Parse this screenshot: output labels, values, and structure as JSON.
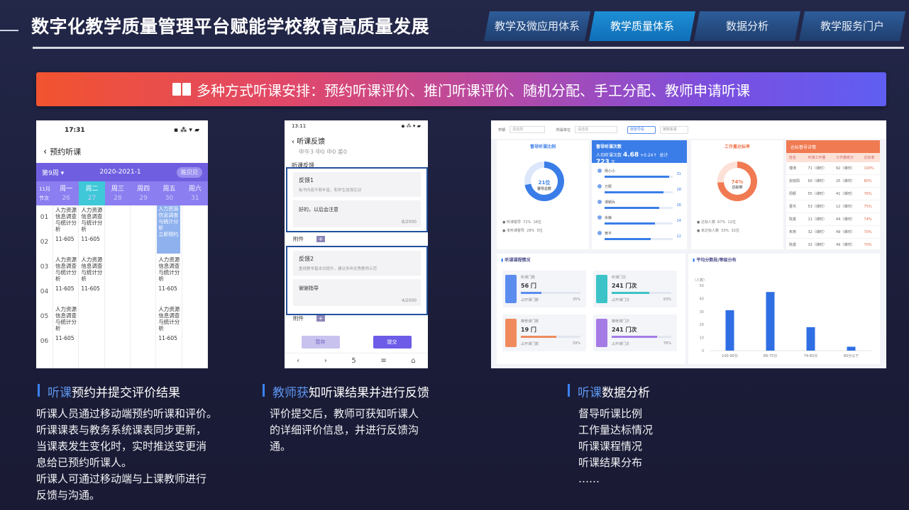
{
  "header": {
    "title": "数字化教学质量管理平台赋能学校教育高质量发展",
    "tabs": [
      {
        "label": "教学及微应用体系",
        "active": false
      },
      {
        "label": "教学质量体系",
        "active": true
      },
      {
        "label": "数据分析",
        "active": false
      },
      {
        "label": "教学服务门户",
        "active": false
      }
    ]
  },
  "banner": {
    "text": "多种方式听课安排：预约听课评价、推门听课评价、随机分配、手工分配、教师申请听课",
    "icon": "book-icon"
  },
  "phone1": {
    "status_time": "17:31",
    "status_icons": "▪ ⁂ ▾ ▰",
    "nav_title": "预约听课",
    "week": "第9周",
    "term": "2020-2021-1",
    "user_pill": "陈贝贝",
    "month": "11月",
    "section_label": "节次",
    "days": [
      {
        "name": "周一",
        "date": "26"
      },
      {
        "name": "周二",
        "date": "27"
      },
      {
        "name": "周三",
        "date": "28"
      },
      {
        "name": "周四",
        "date": "29"
      },
      {
        "name": "周五",
        "date": "30"
      },
      {
        "name": "周六",
        "date": "31"
      }
    ],
    "periods": [
      "01",
      "02",
      "03",
      "04",
      "05",
      "06"
    ],
    "course_name": "人力资源信息调查与统计分析",
    "course_room": "11-605",
    "highlight_text": "人力资源信息调查与统计分析",
    "highlight_action": "立即预约"
  },
  "phone2": {
    "status_time": "13:11",
    "status_icons": "▪ ⁂ ▾ ▰",
    "nav_title": "听课反馈",
    "faded_line": "中午3 中0 中0 差0",
    "section_label": "听课反馈",
    "feedbacks": [
      {
        "title": "反馈1",
        "hint": "板书内容不够丰富，和学生加强互动",
        "reply": "好的，以后会注意",
        "count": "8/2000"
      },
      {
        "title": "反馈2",
        "hint": "重视教学基本功提升，建议多听优秀教师示范",
        "reply": "谢谢指导",
        "count": "4/2000"
      }
    ],
    "attach_label": "附件",
    "btn_save": "暂存",
    "btn_submit": "提交",
    "nav_icons": [
      "‹",
      "›",
      "5",
      "≡",
      "⌂"
    ]
  },
  "dashboard": {
    "filter_labels": [
      "学期",
      "所属单位"
    ],
    "filter_placeholders": [
      "请选择",
      "请选择"
    ],
    "toggles": [
      "按督导看",
      "按院系看"
    ],
    "card1": {
      "title": "督导听课比例",
      "center_value": "21位",
      "center_label": "督导总数",
      "legend": [
        {
          "label": "听课督导",
          "pct": "72%",
          "count": "16位"
        },
        {
          "label": "未听课督导",
          "pct": "28%",
          "count": "5位"
        }
      ]
    },
    "card2": {
      "title": "督导听课次数",
      "sub": "人均听课次数",
      "avg": "4.68",
      "delta": "+0.24↑",
      "total_label": "总计",
      "total": "723",
      "unit": "次",
      "people": [
        {
          "name": "杨小小",
          "value": 31,
          "pct": 0.95
        },
        {
          "name": "万颖",
          "value": 28,
          "pct": 0.86
        },
        {
          "name": "谭朝兵",
          "value": 26,
          "pct": 0.8
        },
        {
          "name": "余静",
          "value": 24,
          "pct": 0.74
        },
        {
          "name": "黄平",
          "value": 22,
          "pct": 0.68
        }
      ]
    },
    "card3": {
      "title": "工作量达标率",
      "center_value": "74%",
      "center_label": "达标率",
      "legend": [
        {
          "label": "达标人数",
          "pct": "67%",
          "count": "12位"
        },
        {
          "label": "未达标人数",
          "pct": "33%",
          "count": "32位"
        }
      ]
    },
    "card4": {
      "title": "达标督导详情",
      "headers": [
        "姓名",
        "听课工作量",
        "工作量统计",
        "达标率"
      ],
      "rows": [
        [
          "傅涛",
          "71（课时）",
          "92（课时）",
          "100%"
        ],
        [
          "张晓阳",
          "60（课时）",
          "25（课时）",
          "80%"
        ],
        [
          "周颖",
          "55（课时）",
          "41（课时）",
          "76%"
        ],
        [
          "曹杰",
          "53（课时）",
          "12（课时）",
          "75%"
        ],
        [
          "陈勇",
          "11（课时）",
          "44（课时）",
          "74%"
        ],
        [
          "朱燕",
          "32（课时）",
          "49（课时）",
          "70%"
        ],
        [
          "陈勇",
          "32（课时）",
          "49（课时）",
          "70%"
        ]
      ]
    },
    "card5": {
      "title": "听课课程情况",
      "tiles": [
        {
          "label": "听课门数",
          "value": "56 门",
          "bottom": "占开课门数",
          "pct": "35%",
          "pct_num": 0.35,
          "color": "#5b8def"
        },
        {
          "label": "听课门次",
          "value": "241 门次",
          "bottom": "占开课门次",
          "pct": "63%",
          "pct_num": 0.63,
          "color": "#3cc3c8"
        },
        {
          "label": "推荐课门数",
          "value": "19 门",
          "bottom": "占开课门数",
          "pct": "59%",
          "pct_num": 0.59,
          "color": "#f08a5d"
        },
        {
          "label": "推荐课门次",
          "value": "241 门次",
          "bottom": "占开课门次",
          "pct": "76%",
          "pct_num": 0.76,
          "color": "#a57ce6"
        }
      ]
    },
    "card6": {
      "title": "平均分数段/等级分布",
      "y_unit": "（人数）"
    }
  },
  "chart_data": {
    "type": "bar",
    "title": "平均分数段/等级分布",
    "ylabel": "（人数）",
    "categories": [
      "100-90分",
      "89-75分",
      "74-60分",
      "60分以下"
    ],
    "values": [
      31,
      45,
      18,
      3
    ],
    "ylim": [
      0,
      50
    ],
    "yticks": [
      0,
      10,
      20,
      30,
      40,
      50
    ],
    "color": "#2f6fe3",
    "grid": false
  },
  "captions": [
    {
      "title_a": "听课",
      "title_b": "预约并提交评价结果",
      "body": [
        "听课人员通过移动端预约听课和评价。",
        "听课课表与教务系统课表同步更新，",
        "当课表发生变化时，实时推送变更消",
        "息给已预约听课人。",
        "听课人可通过移动端与上课教师进行",
        "反馈与沟通。"
      ]
    },
    {
      "title_a": "教师获",
      "title_b": "知听课结果并进行反馈",
      "body": [
        "评价提交后，教师可获知听课人",
        "的详细评价信息，并进行反馈沟",
        "通。"
      ]
    },
    {
      "title_a": "听课",
      "title_b": "数据分析",
      "body": [
        "督导听课比例",
        "工作量达标情况",
        "听课课程情况",
        "听课结果分布",
        "……"
      ]
    }
  ],
  "colors": {
    "accent_blue": "#3b82f6",
    "tab_active": "#1e8fd6",
    "banner_start": "#f2532f",
    "banner_end": "#5f5ef2"
  }
}
